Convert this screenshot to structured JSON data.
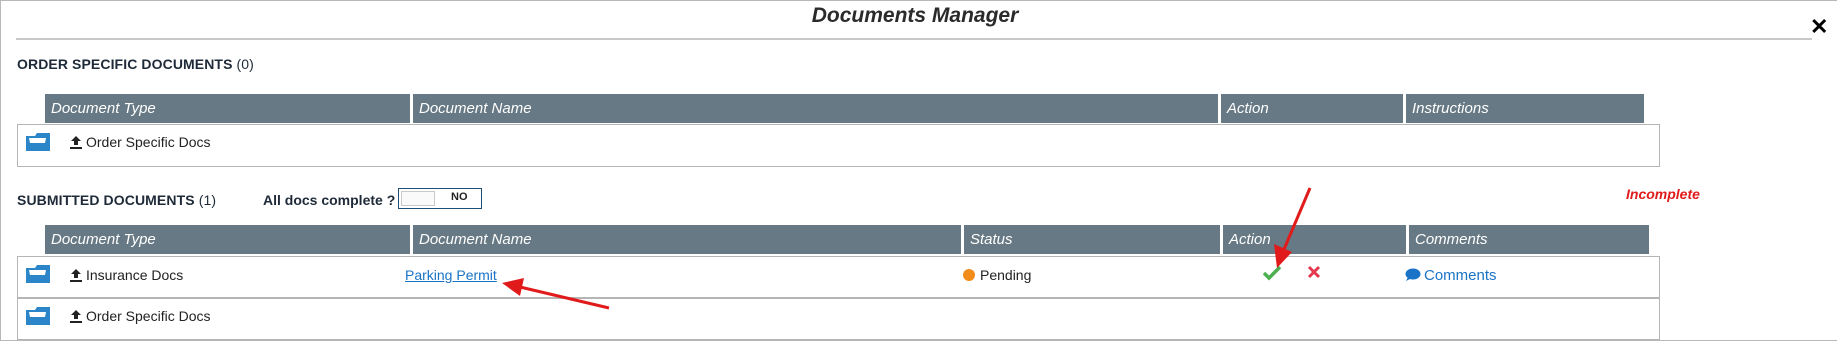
{
  "window": {
    "title": "Documents Manager",
    "close_glyph": "✕"
  },
  "order_section": {
    "title": "ORDER SPECIFIC DOCUMENTS",
    "count": "(0)",
    "columns": [
      "Document Type",
      "Document Name",
      "Action",
      "Instructions"
    ],
    "rows": [
      {
        "document_type": "Order Specific Docs"
      }
    ]
  },
  "submitted_section": {
    "title": "SUBMITTED DOCUMENTS",
    "count": "(1)",
    "all_docs_label": "All docs complete ?",
    "toggle_label": "NO",
    "overall_status": "Incomplete",
    "columns": [
      "Document Type",
      "Document Name",
      "Status",
      "Action",
      "Comments"
    ],
    "rows": [
      {
        "document_type": "Insurance Docs",
        "document_name": "Parking Permit",
        "status": "Pending",
        "comments_label": "Comments"
      },
      {
        "document_type": "Order Specific Docs"
      }
    ]
  },
  "colors": {
    "header_bg": "#677984",
    "pending": "#f28c1b",
    "approve": "#4caf50",
    "reject": "#e53950",
    "link": "#1a73c6",
    "incomplete": "#e11b1b",
    "annotation_arrow": "#e11b1b"
  },
  "icons": [
    "folder-icon",
    "upload-icon",
    "approve-check-icon",
    "reject-x-icon",
    "comment-bubble-icon",
    "close-icon"
  ]
}
